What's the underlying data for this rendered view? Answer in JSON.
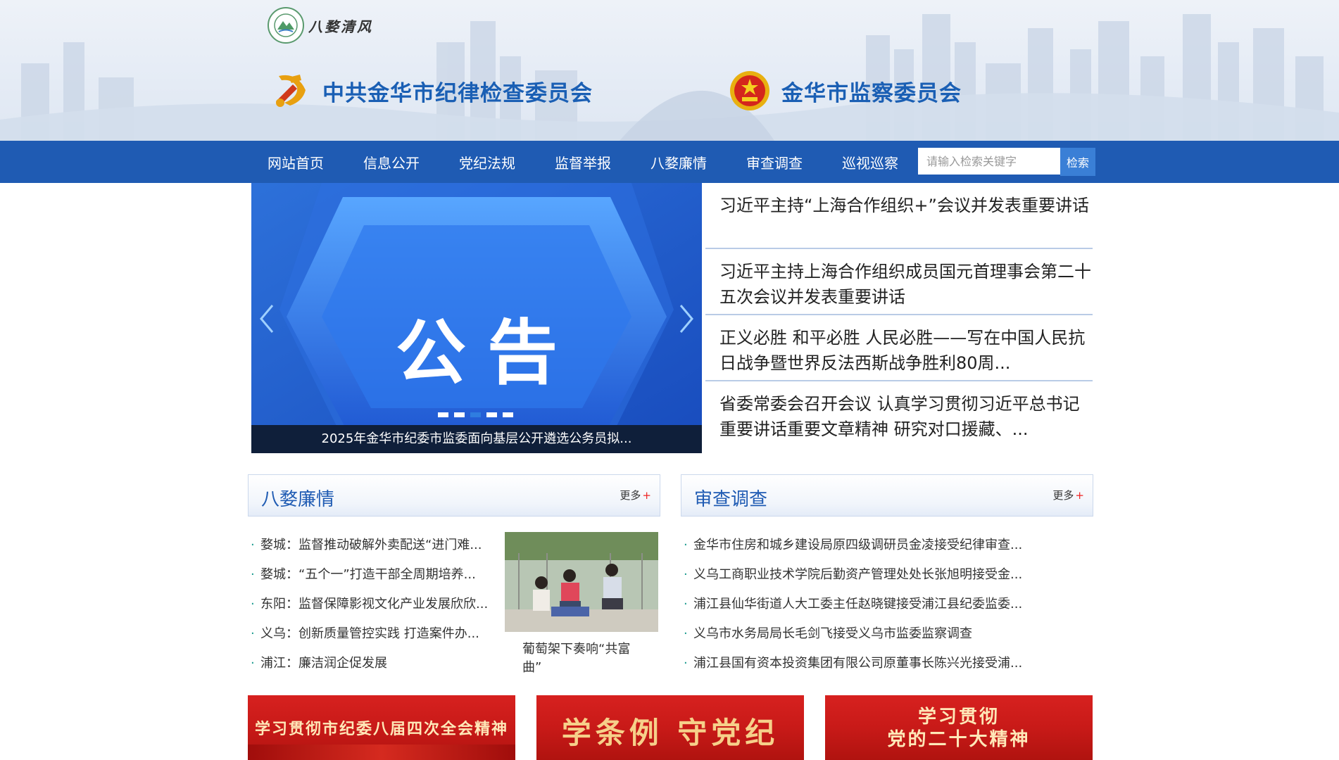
{
  "header": {
    "brand_name": "八婺清风",
    "org_party": "中共金华市纪律检查委员会",
    "org_supervision": "金华市监察委员会"
  },
  "nav": {
    "items": [
      "网站首页",
      "信息公开",
      "党纪法规",
      "监督举报",
      "八婺廉情",
      "审查调查",
      "巡视巡察"
    ],
    "search_placeholder": "请输入检索关键字",
    "search_button": "检索"
  },
  "slider": {
    "slide_title": "公告",
    "caption": "2025年金华市纪委市监委面向基层公开遴选公务员拟...",
    "dot_count": 5,
    "active_dot": 3
  },
  "headlines": [
    "习近平主持“上海合作组织+”会议并发表重要讲话",
    "习近平主持上海合作组织成员国元首理事会第二十五次会议并发表重要讲话",
    "正义必胜 和平必胜 人民必胜——写在中国人民抗日战争暨世界反法西斯战争胜利80周...",
    "省委常委会召开会议 认真学习贯彻习近平总书记重要讲话重要文章精神 研究对口援藏、..."
  ],
  "panels": {
    "bawu": {
      "title": "八婺廉情",
      "more": "更多",
      "items": [
        "婺城：监督推动破解外卖配送“进门难...",
        "婺城：“五个一”打造干部全周期培养...",
        "东阳：监督保障影视文化产业发展欣欣...",
        "义乌：创新质量管控实践 打造案件办...",
        "浦江：廉洁润企促发展"
      ],
      "photo_caption": "葡萄架下奏响“共富曲”"
    },
    "shencha": {
      "title": "审查调查",
      "more": "更多",
      "items": [
        "金华市住房和城乡建设局原四级调研员金凌接受纪律审查...",
        "义乌工商职业技术学院后勤资产管理处处长张旭明接受金...",
        "浦江县仙华街道人大工委主任赵晓键接受浦江县纪委监委...",
        "义乌市水务局局长毛剑飞接受义乌市监委监察调查",
        "浦江县国有资本投资集团有限公司原董事长陈兴光接受浦..."
      ]
    }
  },
  "banners": {
    "b1": "学习贯彻市纪委八届四次全会精神",
    "b2": "学条例 守党纪",
    "b3_line1": "学习贯彻",
    "b3_line2": "党的二十大精神"
  },
  "colors": {
    "nav_bg": "#1f5bb3",
    "org_text": "#1a5fb4",
    "search_button": "#3a7fd6",
    "banner_red": "#c81a18",
    "slider_bg": "#1852c5"
  }
}
